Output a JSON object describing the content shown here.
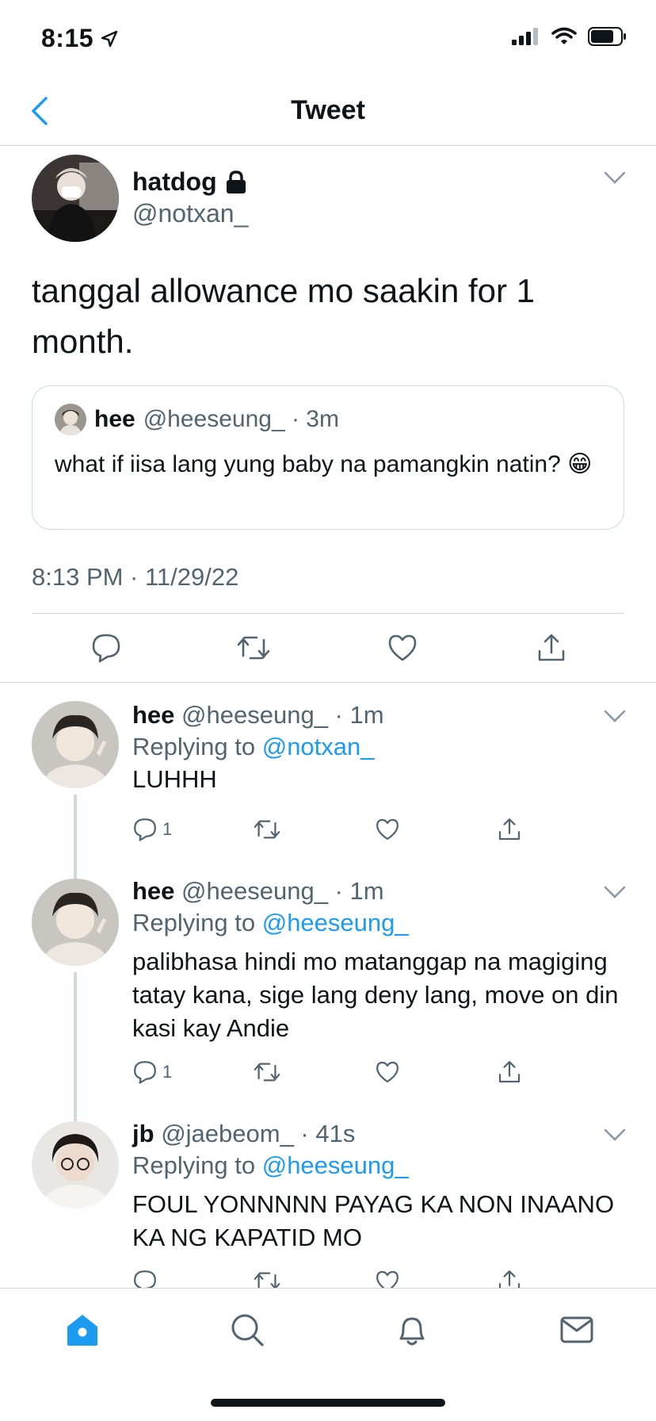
{
  "status_bar": {
    "time": "8:15"
  },
  "header": {
    "title": "Tweet"
  },
  "main_tweet": {
    "name": "hatdog",
    "handle": "@notxan_",
    "text": "tanggal allowance mo saakin for 1 month.",
    "quote": {
      "name": "hee",
      "meta": "@heeseung_ · 3m",
      "text": "what if iisa lang yung baby na pamangkin natin? 😁"
    },
    "timestamp": "8:13 PM · 11/29/22"
  },
  "replies": [
    {
      "name": "hee",
      "meta": "@heeseung_ · 1m",
      "replying_prefix": "Replying to",
      "replying_to": "@notxan_",
      "text": "LUHHH",
      "reply_count": "1"
    },
    {
      "name": "hee",
      "meta": "@heeseung_ · 1m",
      "replying_prefix": "Replying to",
      "replying_to": "@heeseung_",
      "text": "palibhasa hindi mo matanggap na magiging tatay kana, sige lang deny lang, move on din kasi kay Andie",
      "reply_count": "1"
    },
    {
      "name": "jb",
      "meta": "@jaebeom_ · 41s",
      "replying_prefix": "Replying to",
      "replying_to": "@heeseung_",
      "text": "FOUL YONNNNN PAYAG KA NON INAANO KA NG KAPATID MO",
      "reply_count": ""
    }
  ],
  "colors": {
    "accent": "#1d9bf0",
    "secondary_text": "#536471",
    "border": "#d3d6da"
  },
  "tab_bar": {
    "icons": [
      "home-icon",
      "search-icon",
      "bell-icon",
      "mail-icon"
    ]
  }
}
